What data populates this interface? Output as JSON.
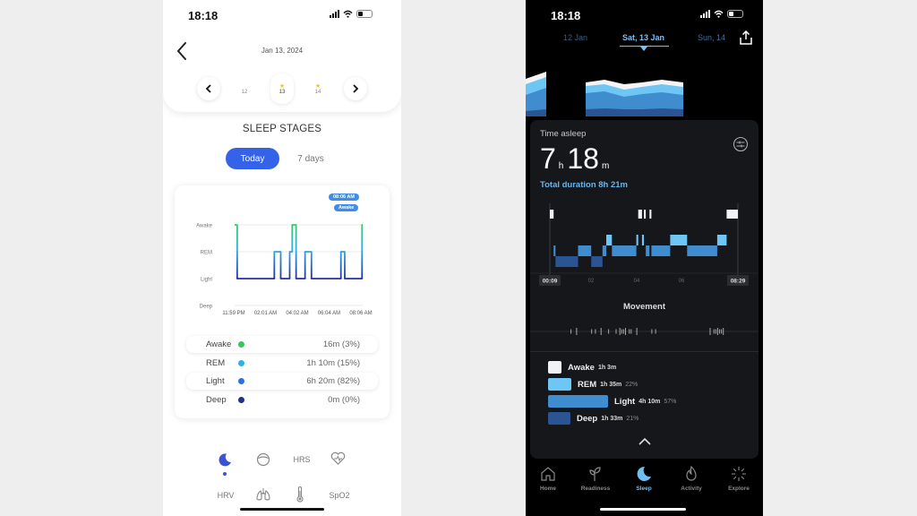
{
  "left_app": {
    "status_bar": {
      "time": "18:18"
    },
    "header": {
      "date": "Jan 13, 2024",
      "days": [
        {
          "label": "12",
          "starred": false,
          "selected": false
        },
        {
          "label": "13",
          "starred": true,
          "selected": true
        },
        {
          "label": "14",
          "starred": true,
          "selected": false
        }
      ],
      "star_glyph": "★"
    },
    "title": "SLEEP STAGES",
    "segments": {
      "today": "Today",
      "seven_days": "7 days",
      "active": "today"
    },
    "chart": {
      "tooltip_time": "08:06 AM",
      "tooltip_stage": "Awake",
      "stages": [
        "Awake",
        "REM",
        "Light",
        "Deep"
      ],
      "x_ticks": [
        "11:59 PM",
        "02:01 AM",
        "04:02 AM",
        "06:04 AM",
        "08:06 AM"
      ],
      "hypnogram": [
        {
          "t": 0.0,
          "stage": "Awake"
        },
        {
          "t": 0.02,
          "stage": "Light"
        },
        {
          "t": 0.31,
          "stage": "REM"
        },
        {
          "t": 0.36,
          "stage": "Light"
        },
        {
          "t": 0.43,
          "stage": "REM"
        },
        {
          "t": 0.45,
          "stage": "Awake"
        },
        {
          "t": 0.48,
          "stage": "Light"
        },
        {
          "t": 0.55,
          "stage": "REM"
        },
        {
          "t": 0.6,
          "stage": "Light"
        },
        {
          "t": 0.83,
          "stage": "REM"
        },
        {
          "t": 0.86,
          "stage": "Light"
        },
        {
          "t": 0.995,
          "stage": "Awake"
        },
        {
          "t": 1.0,
          "stage": "Awake"
        }
      ]
    },
    "legend": [
      {
        "name": "Awake",
        "value": "16m (3%)",
        "color": "#34c759",
        "highlight": true
      },
      {
        "name": "REM",
        "value": "1h 10m (15%)",
        "color": "#2fb0e6",
        "highlight": false
      },
      {
        "name": "Light",
        "value": "6h 20m (82%)",
        "color": "#2f6fde",
        "highlight": true
      },
      {
        "name": "Deep",
        "value": "0m (0%)",
        "color": "#20308c",
        "highlight": false
      }
    ],
    "bottom_nav": {
      "row1": [
        {
          "id": "sleep",
          "icon": "moon-icon",
          "active": true
        },
        {
          "id": "readiness",
          "icon": "circle-gauge-icon"
        },
        {
          "id": "hrs",
          "label": "HRS"
        },
        {
          "id": "heart",
          "icon": "heart-pulse-icon"
        }
      ],
      "row2": [
        {
          "id": "hrv",
          "label": "HRV"
        },
        {
          "id": "lungs",
          "icon": "lungs-icon"
        },
        {
          "id": "temp",
          "icon": "thermometer-icon"
        },
        {
          "id": "spo2",
          "label": "SpO2"
        }
      ]
    },
    "colors": {
      "accent": "#3462e8",
      "awake": "#34c759",
      "rem": "#2fb0e6",
      "light": "#2f6fde",
      "deep": "#20308c"
    }
  },
  "right_app": {
    "status_bar": {
      "time": "18:18"
    },
    "date_nav": {
      "prev": "12 Jan",
      "current": "Sat, 13 Jan",
      "next": "Sun, 14"
    },
    "time_asleep": {
      "label": "Time asleep",
      "hours": "7",
      "hours_unit": "h",
      "minutes": "18",
      "minutes_unit": "m",
      "total": "Total duration 8h 21m"
    },
    "hypnogram": {
      "x_ticks": [
        "00:09",
        "02",
        "04",
        "06",
        "08:29"
      ],
      "start_label": "00:09",
      "end_label": "08:29",
      "segments": [
        {
          "start": 0.0,
          "end": 0.02,
          "stage": "Awake"
        },
        {
          "start": 0.02,
          "end": 0.03,
          "stage": "Light"
        },
        {
          "start": 0.03,
          "end": 0.15,
          "stage": "Deep"
        },
        {
          "start": 0.15,
          "end": 0.22,
          "stage": "Light"
        },
        {
          "start": 0.22,
          "end": 0.28,
          "stage": "Deep"
        },
        {
          "start": 0.28,
          "end": 0.3,
          "stage": "Light"
        },
        {
          "start": 0.3,
          "end": 0.33,
          "stage": "REM"
        },
        {
          "start": 0.33,
          "end": 0.46,
          "stage": "Light"
        },
        {
          "start": 0.46,
          "end": 0.47,
          "stage": "REM"
        },
        {
          "start": 0.47,
          "end": 0.49,
          "stage": "Awake"
        },
        {
          "start": 0.49,
          "end": 0.5,
          "stage": "REM"
        },
        {
          "start": 0.5,
          "end": 0.51,
          "stage": "Awake"
        },
        {
          "start": 0.51,
          "end": 0.53,
          "stage": "Light"
        },
        {
          "start": 0.53,
          "end": 0.54,
          "stage": "Awake"
        },
        {
          "start": 0.54,
          "end": 0.64,
          "stage": "Light"
        },
        {
          "start": 0.64,
          "end": 0.73,
          "stage": "REM"
        },
        {
          "start": 0.73,
          "end": 0.89,
          "stage": "Light"
        },
        {
          "start": 0.89,
          "end": 0.94,
          "stage": "REM"
        },
        {
          "start": 0.94,
          "end": 1.0,
          "stage": "Awake"
        }
      ]
    },
    "movement": {
      "title": "Movement",
      "events": [
        0.11,
        0.14,
        0.22,
        0.24,
        0.27,
        0.31,
        0.35,
        0.37,
        0.38,
        0.39,
        0.4,
        0.42,
        0.43,
        0.46,
        0.54,
        0.56,
        0.85,
        0.87,
        0.88,
        0.89,
        0.9,
        0.91,
        0.92
      ]
    },
    "stages": [
      {
        "name": "Awake",
        "duration": "1h 3m",
        "percent": "",
        "color": "#f2f2f4",
        "share": 0.13
      },
      {
        "name": "REM",
        "duration": "1h 35m",
        "percent": "22%",
        "color": "#6ec6f5",
        "share": 0.22
      },
      {
        "name": "Light",
        "duration": "4h 10m",
        "percent": "57%",
        "color": "#3f8ccf",
        "share": 0.57
      },
      {
        "name": "Deep",
        "duration": "1h 33m",
        "percent": "21%",
        "color": "#2a5592",
        "share": 0.21
      }
    ],
    "tabs": [
      {
        "id": "home",
        "label": "Home",
        "icon": "home-icon"
      },
      {
        "id": "readiness",
        "label": "Readiness",
        "icon": "sprout-icon"
      },
      {
        "id": "sleep",
        "label": "Sleep",
        "icon": "moon-icon",
        "active": true
      },
      {
        "id": "activity",
        "label": "Activity",
        "icon": "flame-icon"
      },
      {
        "id": "explore",
        "label": "Explore",
        "icon": "sparkle-icon"
      }
    ],
    "colors": {
      "accent": "#73bdf1",
      "awake": "#f2f2f4",
      "rem": "#6ec6f5",
      "light": "#3f8ccf",
      "deep": "#2a5592"
    }
  }
}
